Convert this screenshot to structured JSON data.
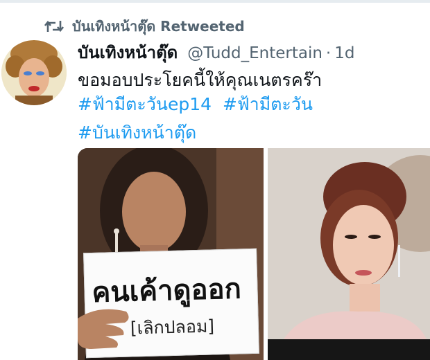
{
  "retweet": {
    "icon": "retweet-icon",
    "text": "บันเทิงหน้าตุ๊ด Retweeted"
  },
  "tweet": {
    "avatar_icon": "avatar",
    "display_name": "บันเทิงหน้าตุ๊ด",
    "handle": "@Tudd_Entertain",
    "separator": "·",
    "time": "1d",
    "text": "ขอมอบประโยคนี้ให้คุณเนตรคร๊า",
    "hashtags": [
      "#ฟ้ามีตะวันep14",
      "#ฟ้ามีตะวัน",
      "#บันเทิงหน้าตุ๊ด"
    ]
  },
  "media": {
    "left_photo": {
      "sign_text": "คนเค้าดูออก",
      "sign_subtext": "[เลิกปลอม]"
    }
  },
  "colors": {
    "link": "#1d9bf0",
    "muted": "#536471",
    "text": "#0f1419"
  }
}
